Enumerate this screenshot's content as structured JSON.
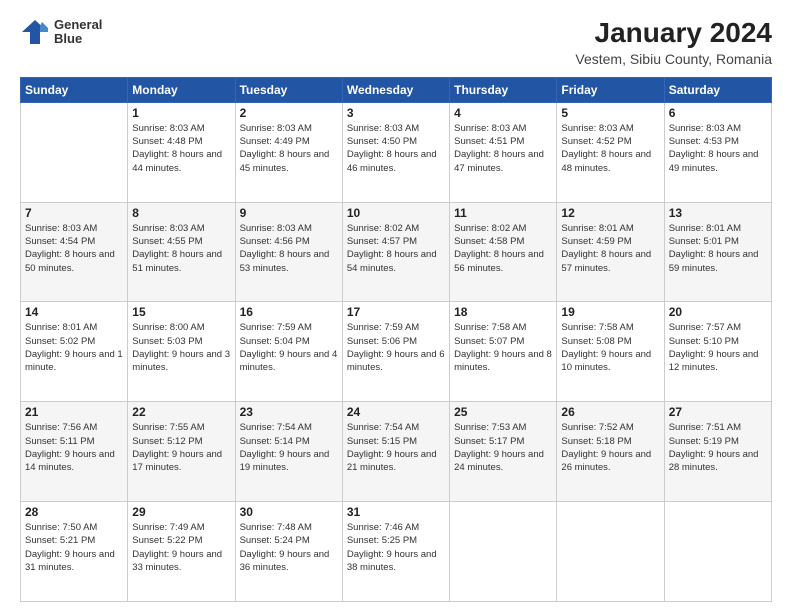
{
  "header": {
    "logo": {
      "line1": "General",
      "line2": "Blue"
    },
    "title": "January 2024",
    "subtitle": "Vestem, Sibiu County, Romania"
  },
  "days_of_week": [
    "Sunday",
    "Monday",
    "Tuesday",
    "Wednesday",
    "Thursday",
    "Friday",
    "Saturday"
  ],
  "weeks": [
    [
      {
        "day": "",
        "sunrise": "",
        "sunset": "",
        "daylight": ""
      },
      {
        "day": "1",
        "sunrise": "Sunrise: 8:03 AM",
        "sunset": "Sunset: 4:48 PM",
        "daylight": "Daylight: 8 hours and 44 minutes."
      },
      {
        "day": "2",
        "sunrise": "Sunrise: 8:03 AM",
        "sunset": "Sunset: 4:49 PM",
        "daylight": "Daylight: 8 hours and 45 minutes."
      },
      {
        "day": "3",
        "sunrise": "Sunrise: 8:03 AM",
        "sunset": "Sunset: 4:50 PM",
        "daylight": "Daylight: 8 hours and 46 minutes."
      },
      {
        "day": "4",
        "sunrise": "Sunrise: 8:03 AM",
        "sunset": "Sunset: 4:51 PM",
        "daylight": "Daylight: 8 hours and 47 minutes."
      },
      {
        "day": "5",
        "sunrise": "Sunrise: 8:03 AM",
        "sunset": "Sunset: 4:52 PM",
        "daylight": "Daylight: 8 hours and 48 minutes."
      },
      {
        "day": "6",
        "sunrise": "Sunrise: 8:03 AM",
        "sunset": "Sunset: 4:53 PM",
        "daylight": "Daylight: 8 hours and 49 minutes."
      }
    ],
    [
      {
        "day": "7",
        "sunrise": "Sunrise: 8:03 AM",
        "sunset": "Sunset: 4:54 PM",
        "daylight": "Daylight: 8 hours and 50 minutes."
      },
      {
        "day": "8",
        "sunrise": "Sunrise: 8:03 AM",
        "sunset": "Sunset: 4:55 PM",
        "daylight": "Daylight: 8 hours and 51 minutes."
      },
      {
        "day": "9",
        "sunrise": "Sunrise: 8:03 AM",
        "sunset": "Sunset: 4:56 PM",
        "daylight": "Daylight: 8 hours and 53 minutes."
      },
      {
        "day": "10",
        "sunrise": "Sunrise: 8:02 AM",
        "sunset": "Sunset: 4:57 PM",
        "daylight": "Daylight: 8 hours and 54 minutes."
      },
      {
        "day": "11",
        "sunrise": "Sunrise: 8:02 AM",
        "sunset": "Sunset: 4:58 PM",
        "daylight": "Daylight: 8 hours and 56 minutes."
      },
      {
        "day": "12",
        "sunrise": "Sunrise: 8:01 AM",
        "sunset": "Sunset: 4:59 PM",
        "daylight": "Daylight: 8 hours and 57 minutes."
      },
      {
        "day": "13",
        "sunrise": "Sunrise: 8:01 AM",
        "sunset": "Sunset: 5:01 PM",
        "daylight": "Daylight: 8 hours and 59 minutes."
      }
    ],
    [
      {
        "day": "14",
        "sunrise": "Sunrise: 8:01 AM",
        "sunset": "Sunset: 5:02 PM",
        "daylight": "Daylight: 9 hours and 1 minute."
      },
      {
        "day": "15",
        "sunrise": "Sunrise: 8:00 AM",
        "sunset": "Sunset: 5:03 PM",
        "daylight": "Daylight: 9 hours and 3 minutes."
      },
      {
        "day": "16",
        "sunrise": "Sunrise: 7:59 AM",
        "sunset": "Sunset: 5:04 PM",
        "daylight": "Daylight: 9 hours and 4 minutes."
      },
      {
        "day": "17",
        "sunrise": "Sunrise: 7:59 AM",
        "sunset": "Sunset: 5:06 PM",
        "daylight": "Daylight: 9 hours and 6 minutes."
      },
      {
        "day": "18",
        "sunrise": "Sunrise: 7:58 AM",
        "sunset": "Sunset: 5:07 PM",
        "daylight": "Daylight: 9 hours and 8 minutes."
      },
      {
        "day": "19",
        "sunrise": "Sunrise: 7:58 AM",
        "sunset": "Sunset: 5:08 PM",
        "daylight": "Daylight: 9 hours and 10 minutes."
      },
      {
        "day": "20",
        "sunrise": "Sunrise: 7:57 AM",
        "sunset": "Sunset: 5:10 PM",
        "daylight": "Daylight: 9 hours and 12 minutes."
      }
    ],
    [
      {
        "day": "21",
        "sunrise": "Sunrise: 7:56 AM",
        "sunset": "Sunset: 5:11 PM",
        "daylight": "Daylight: 9 hours and 14 minutes."
      },
      {
        "day": "22",
        "sunrise": "Sunrise: 7:55 AM",
        "sunset": "Sunset: 5:12 PM",
        "daylight": "Daylight: 9 hours and 17 minutes."
      },
      {
        "day": "23",
        "sunrise": "Sunrise: 7:54 AM",
        "sunset": "Sunset: 5:14 PM",
        "daylight": "Daylight: 9 hours and 19 minutes."
      },
      {
        "day": "24",
        "sunrise": "Sunrise: 7:54 AM",
        "sunset": "Sunset: 5:15 PM",
        "daylight": "Daylight: 9 hours and 21 minutes."
      },
      {
        "day": "25",
        "sunrise": "Sunrise: 7:53 AM",
        "sunset": "Sunset: 5:17 PM",
        "daylight": "Daylight: 9 hours and 24 minutes."
      },
      {
        "day": "26",
        "sunrise": "Sunrise: 7:52 AM",
        "sunset": "Sunset: 5:18 PM",
        "daylight": "Daylight: 9 hours and 26 minutes."
      },
      {
        "day": "27",
        "sunrise": "Sunrise: 7:51 AM",
        "sunset": "Sunset: 5:19 PM",
        "daylight": "Daylight: 9 hours and 28 minutes."
      }
    ],
    [
      {
        "day": "28",
        "sunrise": "Sunrise: 7:50 AM",
        "sunset": "Sunset: 5:21 PM",
        "daylight": "Daylight: 9 hours and 31 minutes."
      },
      {
        "day": "29",
        "sunrise": "Sunrise: 7:49 AM",
        "sunset": "Sunset: 5:22 PM",
        "daylight": "Daylight: 9 hours and 33 minutes."
      },
      {
        "day": "30",
        "sunrise": "Sunrise: 7:48 AM",
        "sunset": "Sunset: 5:24 PM",
        "daylight": "Daylight: 9 hours and 36 minutes."
      },
      {
        "day": "31",
        "sunrise": "Sunrise: 7:46 AM",
        "sunset": "Sunset: 5:25 PM",
        "daylight": "Daylight: 9 hours and 38 minutes."
      },
      {
        "day": "",
        "sunrise": "",
        "sunset": "",
        "daylight": ""
      },
      {
        "day": "",
        "sunrise": "",
        "sunset": "",
        "daylight": ""
      },
      {
        "day": "",
        "sunrise": "",
        "sunset": "",
        "daylight": ""
      }
    ]
  ]
}
